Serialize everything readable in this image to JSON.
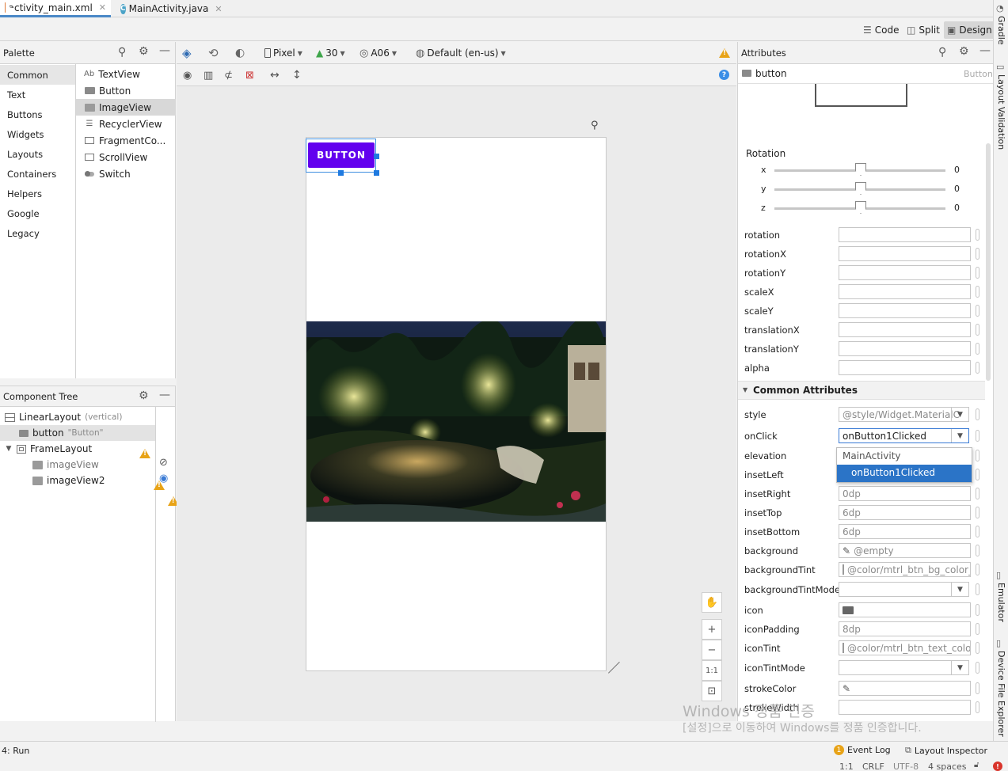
{
  "tabs": [
    {
      "label": "activity_main.xml",
      "icon": "xml-file-icon",
      "active": true
    },
    {
      "label": "MainActivity.java",
      "icon": "java-class-icon",
      "active": false
    }
  ],
  "view_modes": {
    "code": "Code",
    "split": "Split",
    "design": "Design",
    "selected": "Design"
  },
  "palette": {
    "title": "Palette",
    "categories": [
      "Common",
      "Text",
      "Buttons",
      "Widgets",
      "Layouts",
      "Containers",
      "Helpers",
      "Google",
      "Legacy"
    ],
    "selected_category": "Common",
    "items": [
      "TextView",
      "Button",
      "ImageView",
      "RecyclerView",
      "FragmentCo...",
      "ScrollView",
      "Switch"
    ],
    "items_prefix_textview": "Ab",
    "selected_item": "ImageView"
  },
  "design_toolbar": {
    "device": "Pixel",
    "api": "30",
    "theme": "A06",
    "locale": "Default (en-us)"
  },
  "component_tree": {
    "title": "Component Tree",
    "nodes": [
      {
        "label": "LinearLayout",
        "sub": "(vertical)"
      },
      {
        "label": "button",
        "sub": "\"Button\""
      },
      {
        "label": "FrameLayout",
        "sub": ""
      },
      {
        "label": "imageView",
        "sub": ""
      },
      {
        "label": "imageView2",
        "sub": ""
      }
    ]
  },
  "preview": {
    "button_label": "BUTTON"
  },
  "zoom": {
    "plus": "+",
    "minus": "−",
    "one_to_one": "1:1"
  },
  "attributes": {
    "title": "Attributes",
    "component_name": "button",
    "component_type": "Button",
    "rotation_section": "Rotation",
    "rotation_axes": [
      {
        "axis": "x",
        "value": "0"
      },
      {
        "axis": "y",
        "value": "0"
      },
      {
        "axis": "z",
        "value": "0"
      }
    ],
    "transform_rows": [
      "rotation",
      "rotationX",
      "rotationY",
      "scaleX",
      "scaleY",
      "translationX",
      "translationY",
      "alpha"
    ],
    "common_section": "Common Attributes",
    "common_rows": [
      {
        "label": "style",
        "value": "@style/Widget.MaterialC"
      },
      {
        "label": "onClick",
        "value": "onButton1Clicked"
      },
      {
        "label": "elevation",
        "value": ""
      },
      {
        "label": "insetLeft",
        "value": ""
      },
      {
        "label": "insetRight",
        "value": "0dp"
      },
      {
        "label": "insetTop",
        "value": "6dp"
      },
      {
        "label": "insetBottom",
        "value": "6dp"
      },
      {
        "label": "background",
        "value": "@empty"
      },
      {
        "label": "backgroundTint",
        "value": "@color/mtrl_btn_bg_color_"
      },
      {
        "label": "backgroundTintMode",
        "value": ""
      },
      {
        "label": "icon",
        "value": ""
      },
      {
        "label": "iconPadding",
        "value": "8dp"
      },
      {
        "label": "iconTint",
        "value": "@color/mtrl_btn_text_color"
      },
      {
        "label": "iconTintMode",
        "value": ""
      },
      {
        "label": "strokeColor",
        "value": ""
      },
      {
        "label": "strokeWidth",
        "value": ""
      }
    ],
    "onclick_popup": {
      "group": "MainActivity",
      "option": "onButton1Clicked"
    }
  },
  "side_tools": {
    "gradle": "Gradle",
    "layout_validation": "Layout Validation",
    "emulator": "Emulator",
    "device_file_explorer": "Device File Explorer"
  },
  "status": {
    "run": "4: Run",
    "event_log_count": "1",
    "event_log": "Event Log",
    "layout_inspector": "Layout Inspector",
    "position": "1:1",
    "line_sep": "CRLF",
    "encoding": "UTF-8",
    "indent": "4 spaces",
    "error_count": "1"
  },
  "watermark": {
    "line1": "Windows 정품 인증",
    "line2": "[설정]으로 이동하여 Windows를 정품 인증합니다."
  },
  "colors": {
    "accent": "#6200ee",
    "selection": "#2b74c7",
    "warning": "#e8a317",
    "error": "#d9342b"
  }
}
